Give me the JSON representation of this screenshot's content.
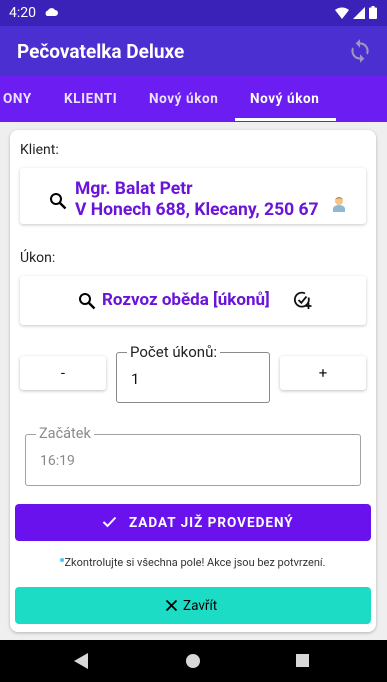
{
  "status_bar": {
    "time": "4:20"
  },
  "app_bar": {
    "title": "Pečovatelka Deluxe"
  },
  "tabs": [
    {
      "label": "ONY",
      "active": false
    },
    {
      "label": "KLIENTI",
      "active": false
    },
    {
      "label": "Nový úkon",
      "active": false
    },
    {
      "label": "Nový úkon",
      "active": true
    }
  ],
  "form": {
    "client_label": "Klient:",
    "client_name": "Mgr. Balat Petr",
    "client_address": "V Honech 688, Klecany, 250 67",
    "service_label": "Úkon:",
    "service_value": "Rozvoz oběda [úkonů]",
    "count": {
      "minus_label": "-",
      "plus_label": "+",
      "legend": "Počet úkonů:",
      "value": "1"
    },
    "start": {
      "legend": "Začátek",
      "value": "16:19"
    },
    "submit_label": "ZADAT JIŽ PROVEDENÝ",
    "warning": "Zkontrolujte si všechna pole! Akce jsou bez potvrzení.",
    "close_label": "Zavřít"
  },
  "colors": {
    "status_bar": "#3a22b8",
    "app_bar": "#4b2fd1",
    "tab_bar": "#6b1df2",
    "accent_text": "#6a14d9",
    "primary_button": "#6a12ee",
    "close_button": "#1ddcc6"
  }
}
